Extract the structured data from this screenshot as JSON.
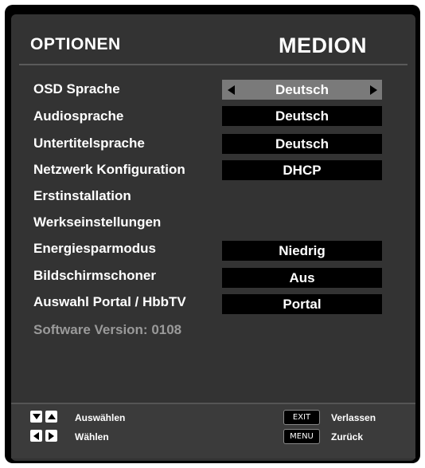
{
  "header": {
    "title": "OPTIONEN",
    "brand": "MEDION"
  },
  "menu": [
    {
      "label": "OSD Sprache",
      "value": "Deutsch",
      "selected": true
    },
    {
      "label": "Audiosprache",
      "value": "Deutsch"
    },
    {
      "label": "Untertitelsprache",
      "value": "Deutsch"
    },
    {
      "label": "Netzwerk Konfiguration",
      "value": "DHCP"
    },
    {
      "label": "Erstinstallation"
    },
    {
      "label": "Werkseinstellungen"
    },
    {
      "label": "Energiesparmodus",
      "value": "Niedrig"
    },
    {
      "label": "Bildschirmschoner",
      "value": "Aus"
    },
    {
      "label": "Auswahl Portal / HbbTV",
      "value": "Portal"
    }
  ],
  "software_version": "Software Version: 0108",
  "footer": {
    "select_label": "Auswählen",
    "choose_label": "Wählen",
    "exit_key": "EXIT",
    "exit_label": "Verlassen",
    "menu_key": "MENU",
    "menu_label": "Zurück"
  },
  "colors": {
    "background": "#333333",
    "selected_value": "#7a7a7a",
    "value_box": "#000000",
    "dim_text": "#9a9a9a"
  }
}
